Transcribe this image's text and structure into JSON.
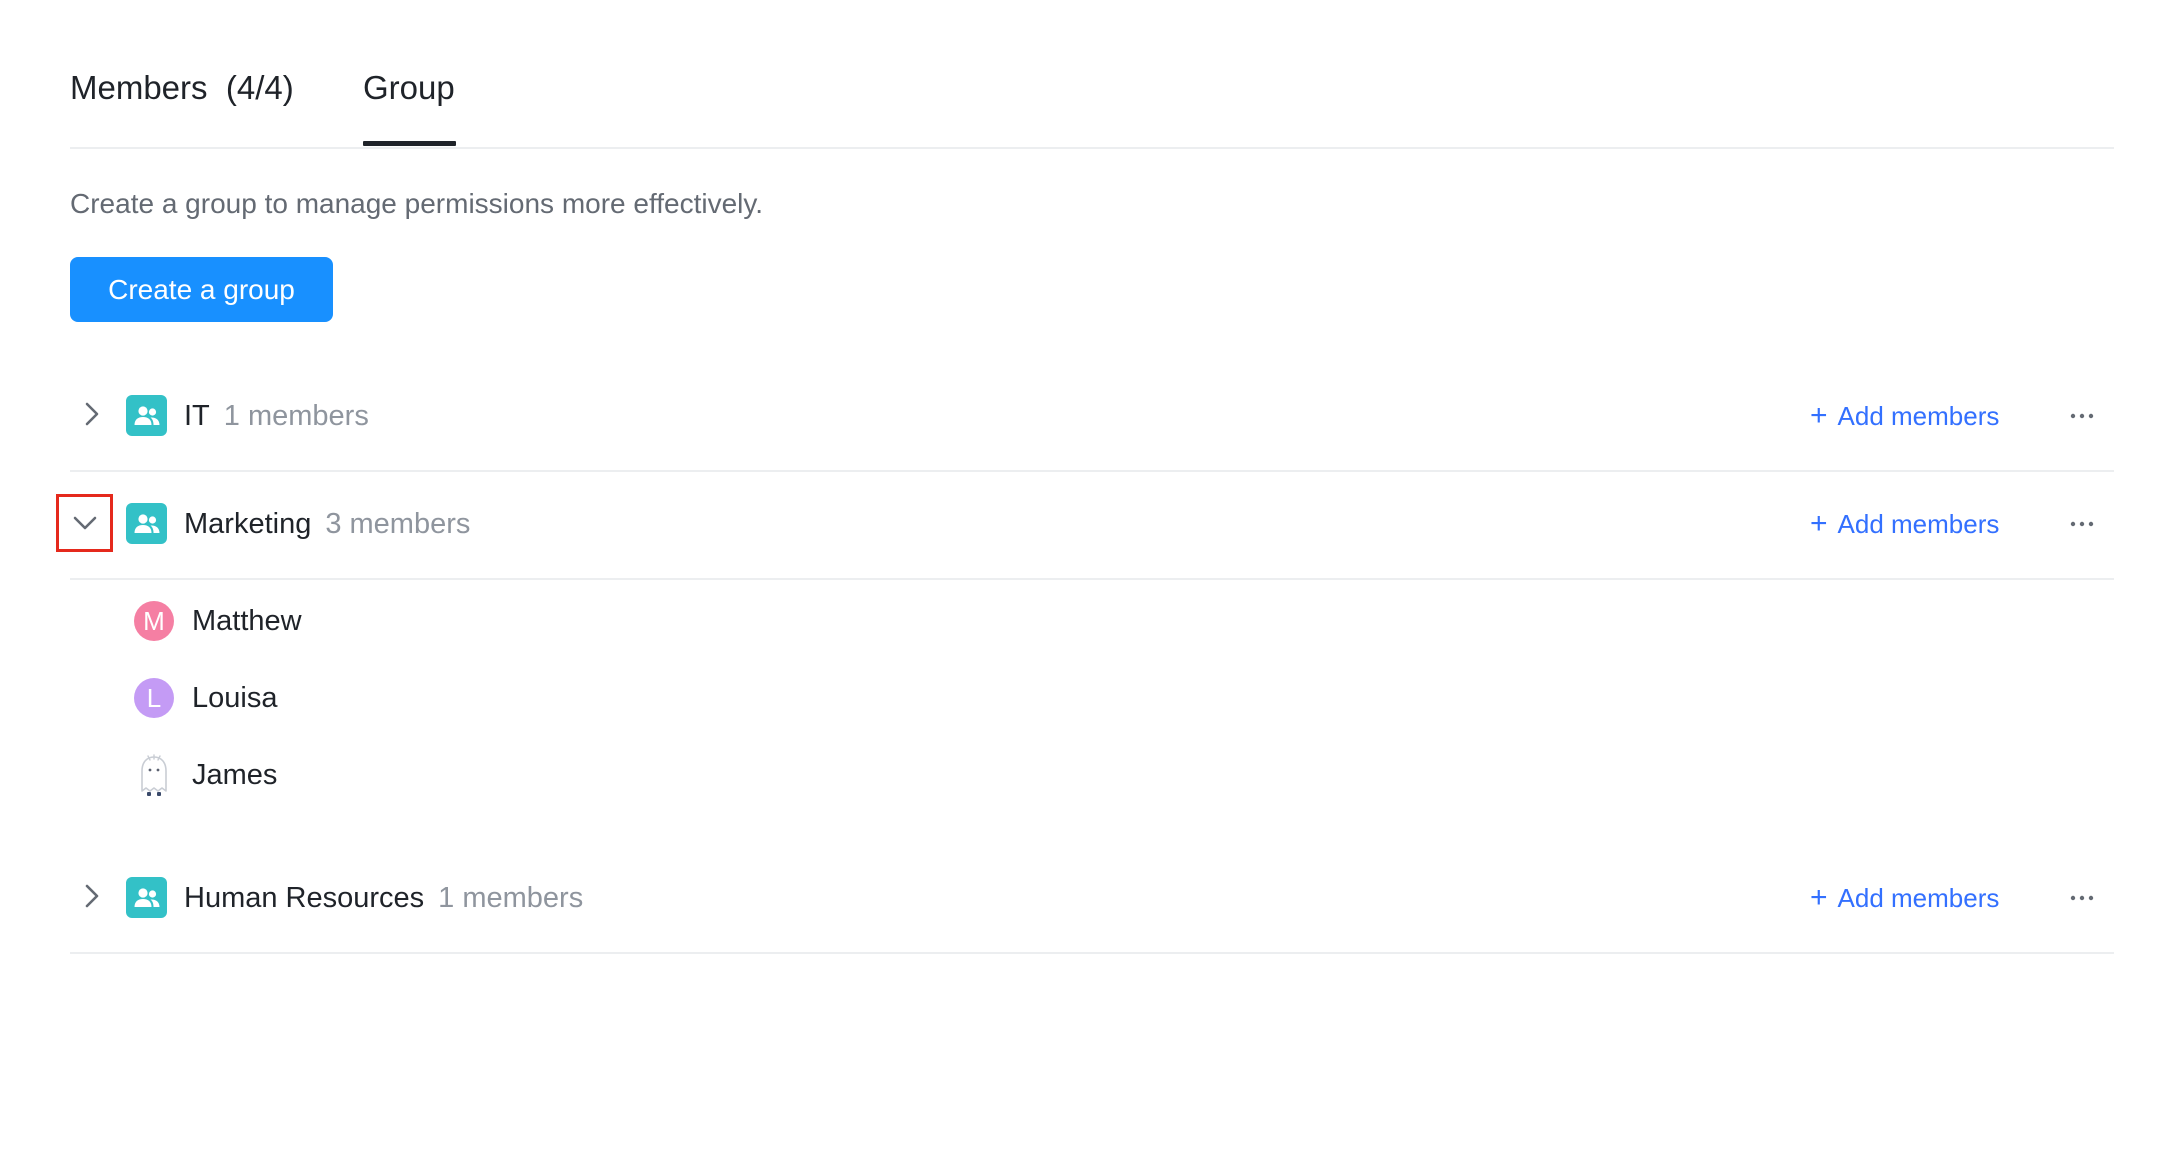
{
  "tabs": {
    "members_label": "Members",
    "members_count": "(4/4)",
    "group_label": "Group"
  },
  "description": "Create a group to manage permissions more effectively.",
  "create_button": "Create a group",
  "groups": [
    {
      "name": "IT",
      "count": "1 members",
      "expanded": false,
      "add_label": "Add members",
      "members": []
    },
    {
      "name": "Marketing",
      "count": "3 members",
      "expanded": true,
      "add_label": "Add members",
      "members": [
        {
          "name": "Matthew",
          "initial": "M",
          "color": "#f57fa3"
        },
        {
          "name": "Louisa",
          "initial": "L",
          "color": "#c49bf5"
        },
        {
          "name": "James",
          "initial": "",
          "color": "#ffffff",
          "icon": "ghost-avatar-icon"
        }
      ]
    },
    {
      "name": "Human Resources",
      "count": "1 members",
      "expanded": false,
      "add_label": "Add members",
      "members": []
    }
  ],
  "colors": {
    "primary": "#1890ff",
    "link": "#3370ff",
    "group_icon": "#33c1c7",
    "highlight": "#e5291c"
  },
  "icons": {
    "collapsed": "chevron-right-icon",
    "expanded": "chevron-down-icon",
    "group": "group-users-icon",
    "add": "plus-icon",
    "more": "more-horizontal-icon"
  }
}
